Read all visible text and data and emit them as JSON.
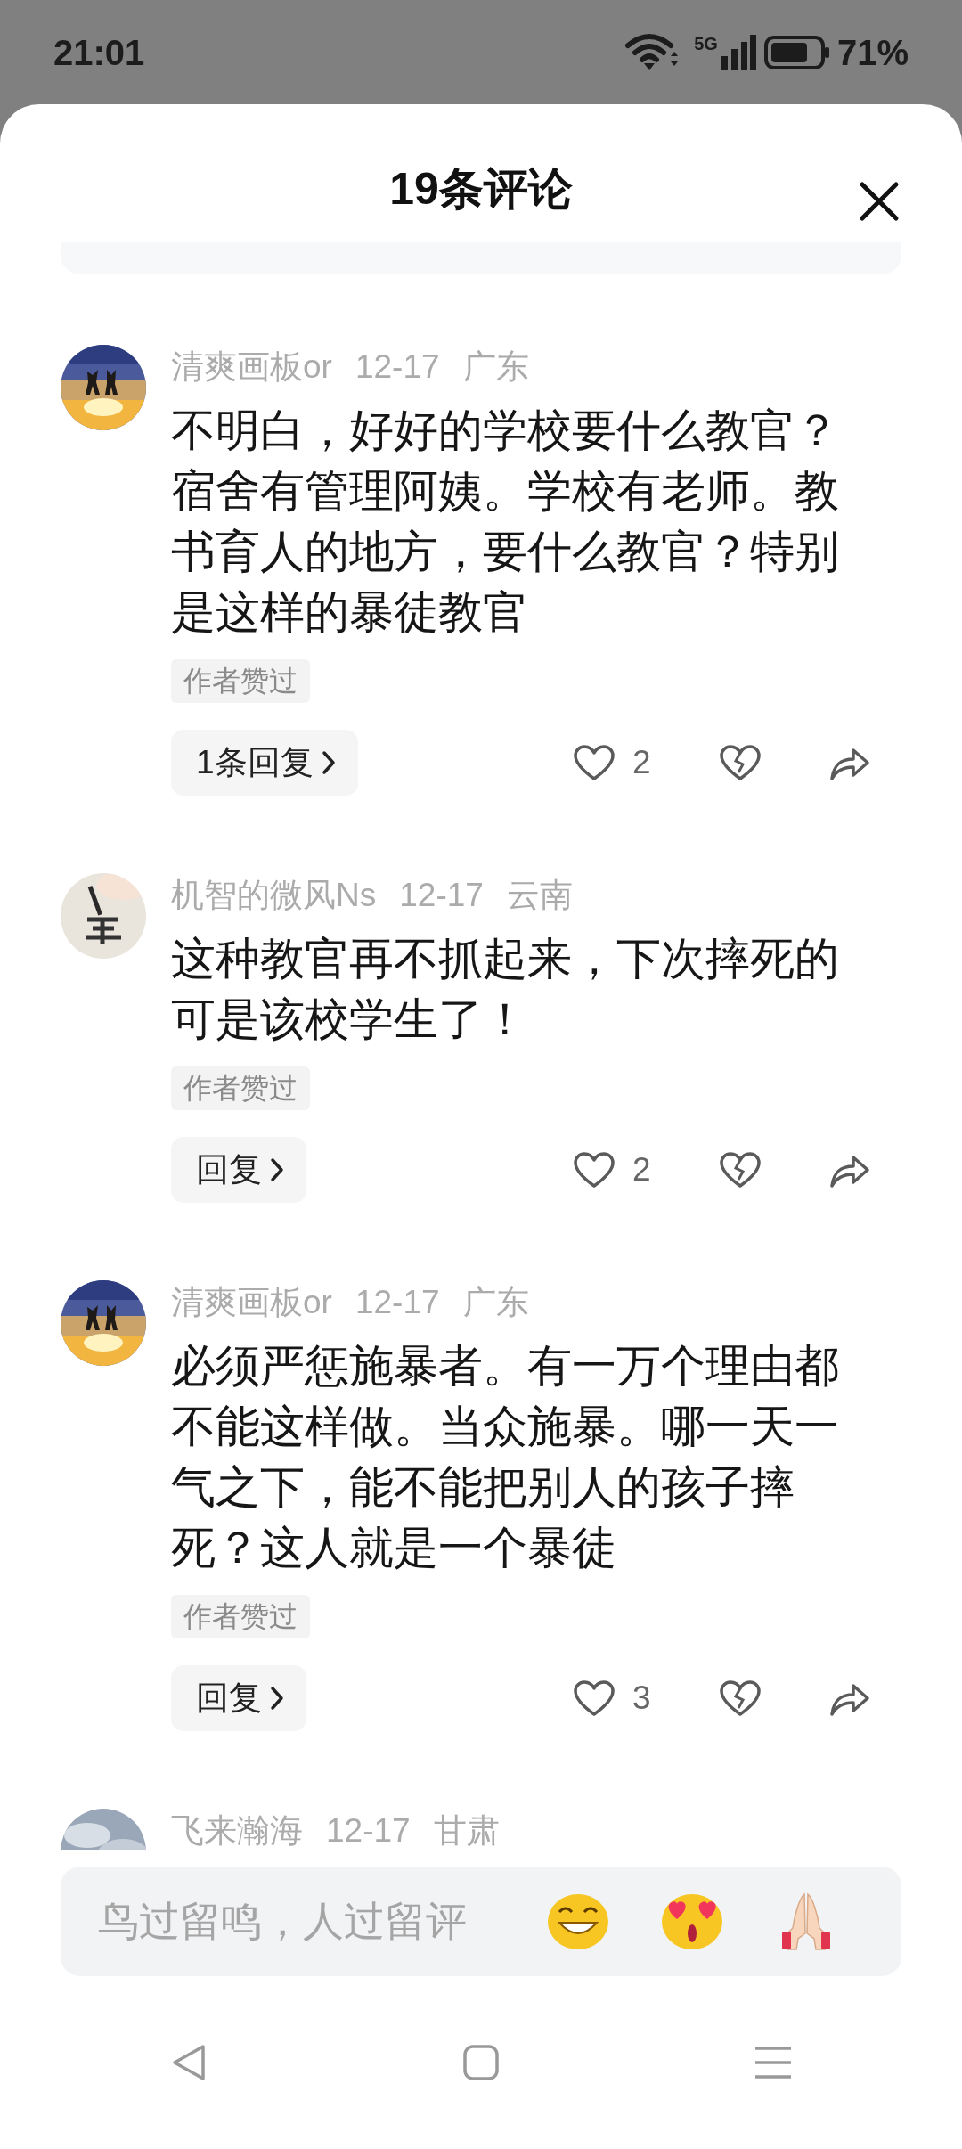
{
  "status_bar": {
    "time": "21:01",
    "network": "5G",
    "battery": "71%"
  },
  "sheet": {
    "title": "19条评论"
  },
  "comments": [
    {
      "user": "清爽画板or",
      "date": "12-17",
      "location": "广东",
      "text": "不明白，好好的学校要什么教官？宿舍有管理阿姨。学校有老师。教书育人的地方，要什么教官？特别是这样的暴徒教官",
      "tag": "作者赞过",
      "reply": "1条回复",
      "likes": "2",
      "liked": false,
      "disliked": false
    },
    {
      "user": "机智的微风Ns",
      "date": "12-17",
      "location": "云南",
      "text": "这种教官再不抓起来，下次摔死的可是该校学生了！",
      "tag": "作者赞过",
      "reply": "回复",
      "likes": "2",
      "liked": false,
      "disliked": false
    },
    {
      "user": "清爽画板or",
      "date": "12-17",
      "location": "广东",
      "text": "必须严惩施暴者。有一万个理由都不能这样做。当众施暴。哪一天一气之下，能不能把别人的孩子摔死？这人就是一个暴徒",
      "tag": "作者赞过",
      "reply": "回复",
      "likes": "3",
      "liked": false,
      "disliked": false
    },
    {
      "user": "飞来瀚海",
      "date": "12-17",
      "location": "甘肃"
    }
  ],
  "composer": {
    "placeholder": "鸟过留鸣，人过留评"
  }
}
